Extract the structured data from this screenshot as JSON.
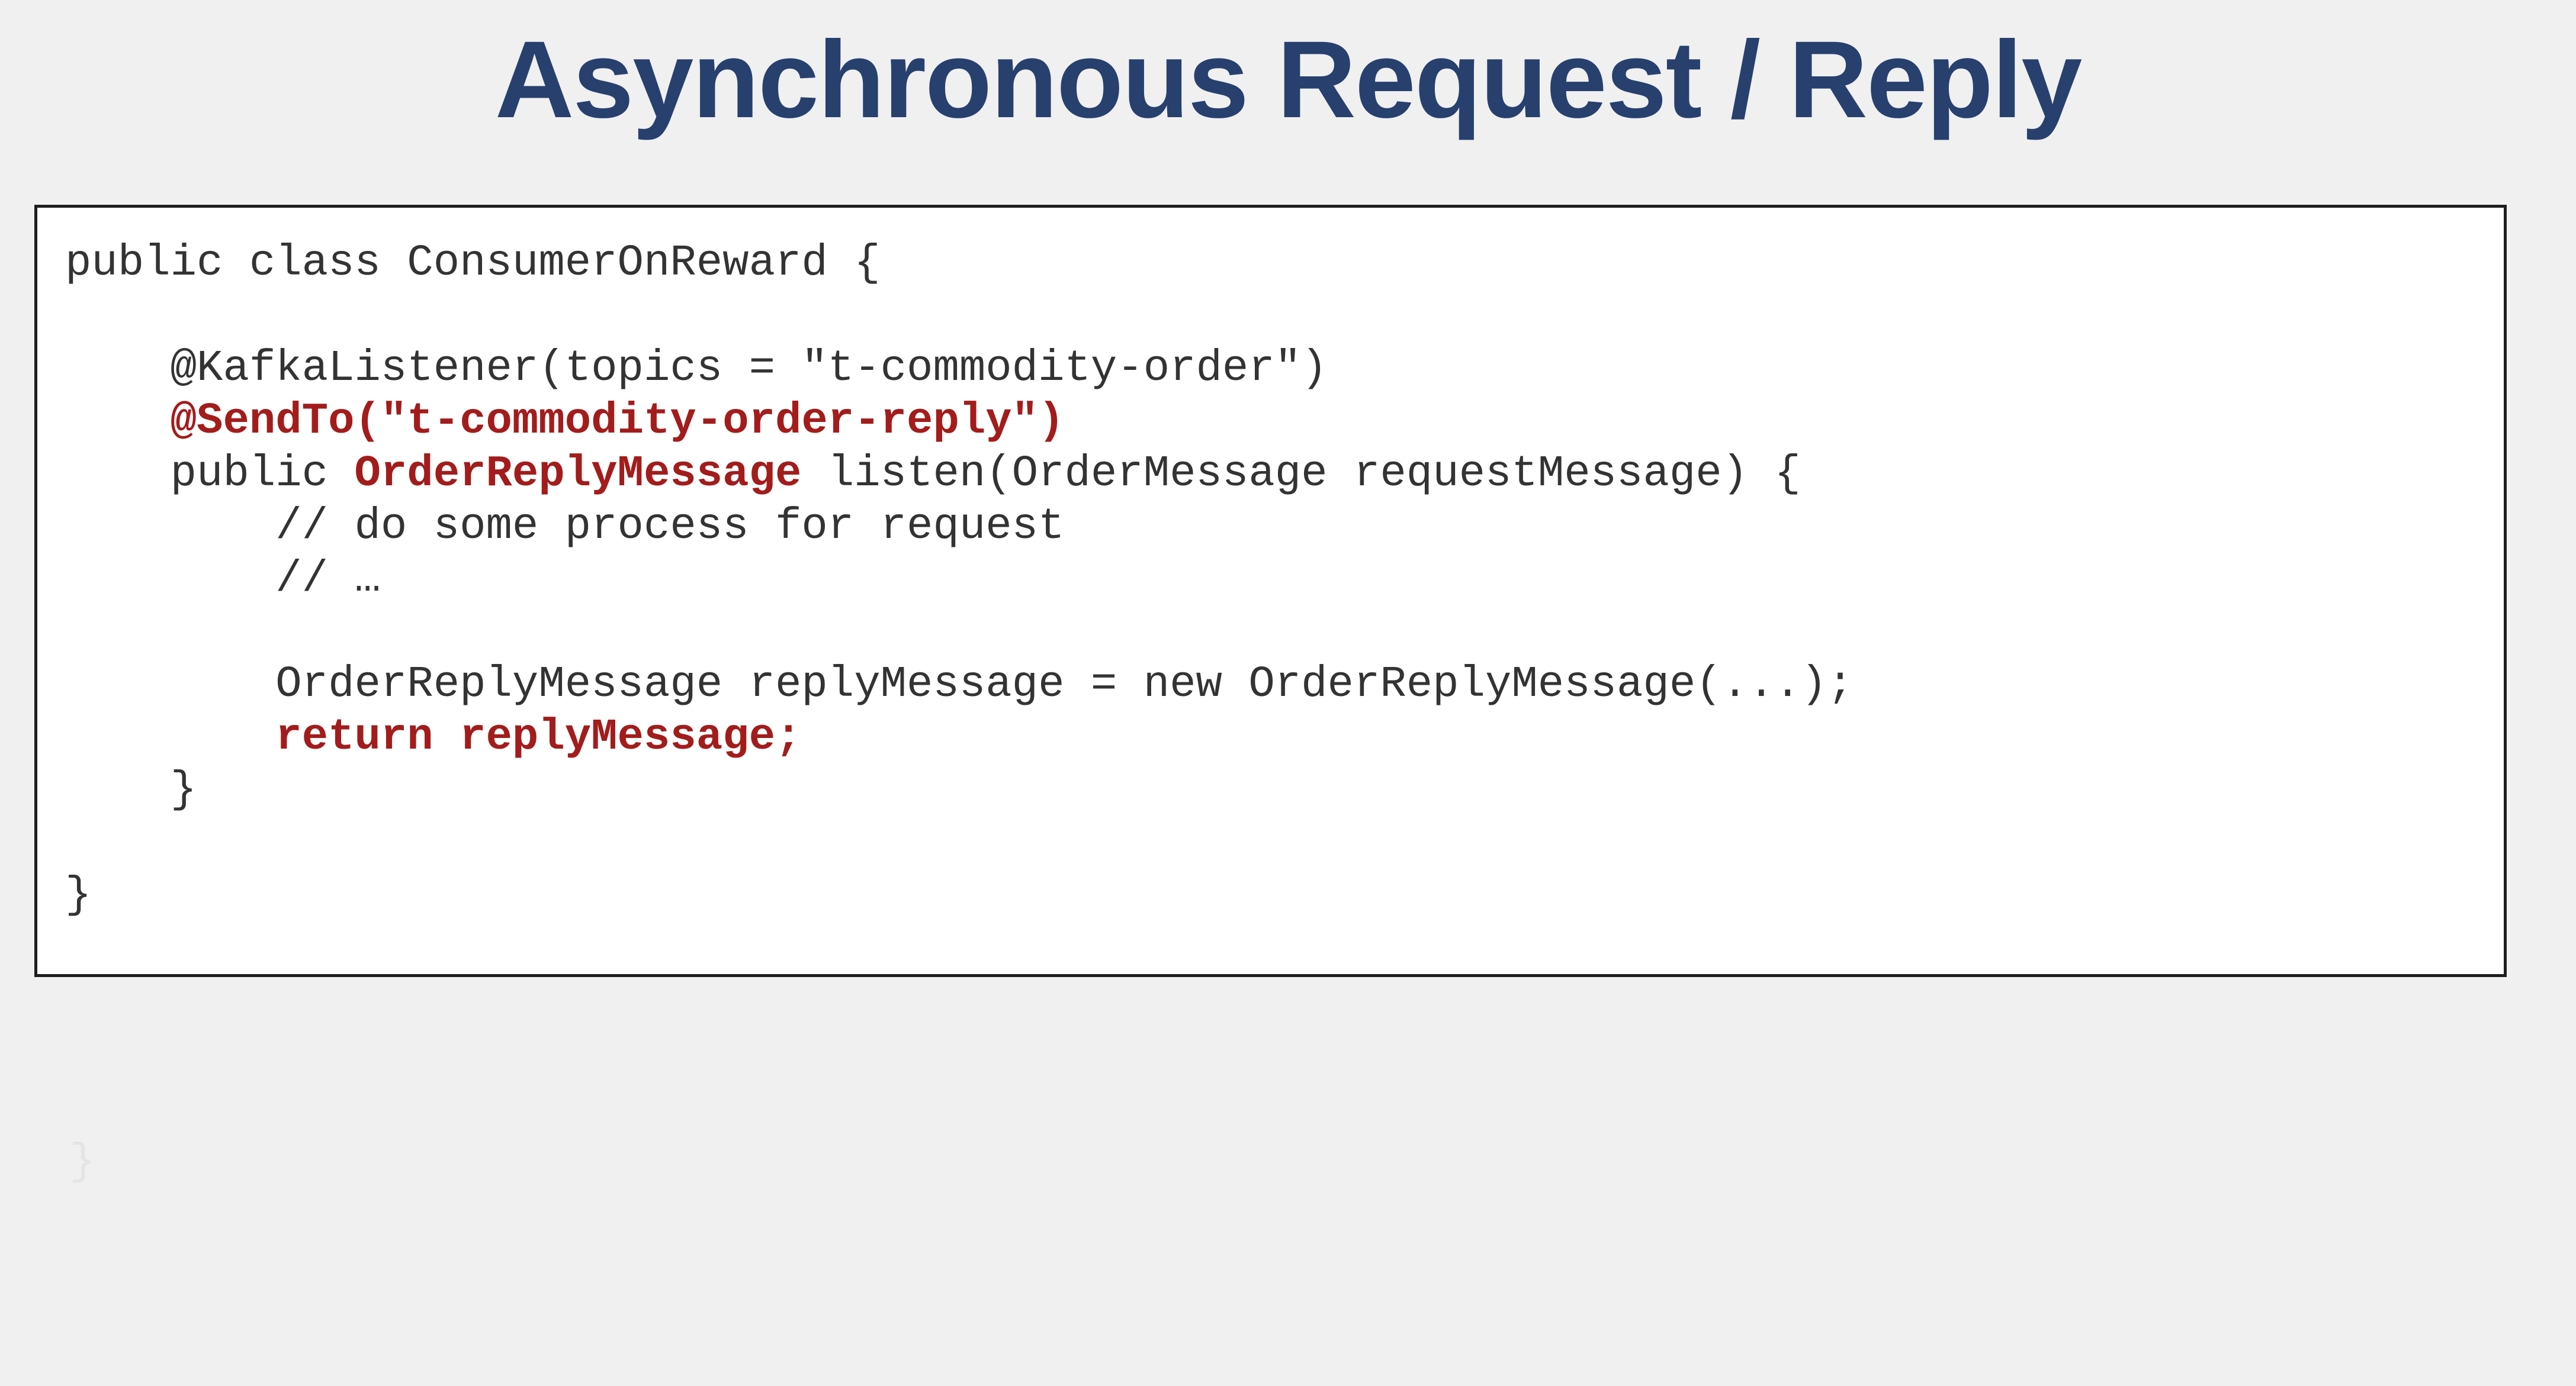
{
  "slide": {
    "title": "Asynchronous Request / Reply"
  },
  "code": {
    "lines": [
      [
        {
          "text": "public class ConsumerOnReward {",
          "highlight": false
        }
      ],
      [],
      [
        {
          "text": "    @KafkaListener(topics = \"t-commodity-order\")",
          "highlight": false
        }
      ],
      [
        {
          "text": "    ",
          "highlight": false
        },
        {
          "text": "@SendTo(\"t-commodity-order-reply\")",
          "highlight": true
        }
      ],
      [
        {
          "text": "    public ",
          "highlight": false
        },
        {
          "text": "OrderReplyMessage",
          "highlight": true
        },
        {
          "text": " listen(OrderMessage requestMessage) {",
          "highlight": false
        }
      ],
      [
        {
          "text": "        // do some process for request",
          "highlight": false
        }
      ],
      [
        {
          "text": "        // …",
          "highlight": false
        }
      ],
      [],
      [
        {
          "text": "        OrderReplyMessage replyMessage = new OrderReplyMessage(...);",
          "highlight": false
        }
      ],
      [
        {
          "text": "        ",
          "highlight": false
        },
        {
          "text": "return replyMessage;",
          "highlight": true
        }
      ],
      [
        {
          "text": "    }",
          "highlight": false
        }
      ],
      [],
      [
        {
          "text": "}",
          "highlight": false
        }
      ]
    ]
  },
  "faded_mark": "}",
  "colors": {
    "background": "#f0f0f0",
    "title": "#27406e",
    "code_text": "#333333",
    "code_highlight": "#a31c1c",
    "code_box_border": "#1e1e1e"
  }
}
